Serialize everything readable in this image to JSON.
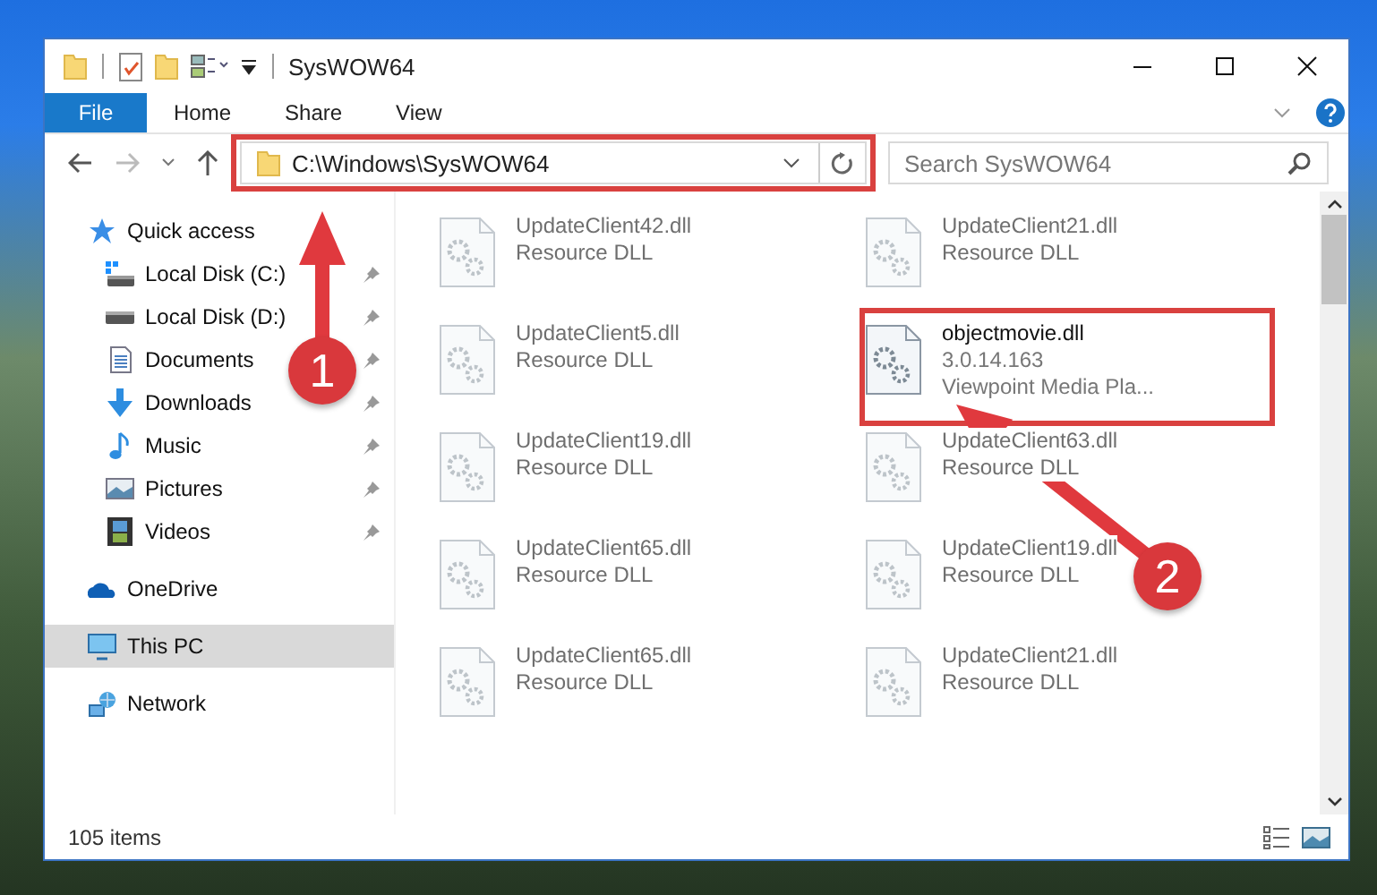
{
  "window": {
    "title": "SysWOW64"
  },
  "ribbon_tabs": [
    {
      "label": "File",
      "kind": "file_menu"
    },
    {
      "label": "Home",
      "kind": "tab"
    },
    {
      "label": "Share",
      "kind": "tab"
    },
    {
      "label": "View",
      "kind": "tab"
    }
  ],
  "address_bar": {
    "path": "C:\\Windows\\SysWOW64"
  },
  "search": {
    "placeholder": "Search SysWOW64"
  },
  "navigation": [
    {
      "label": "Quick access",
      "kind": "star",
      "selected": false,
      "children": [
        {
          "label": "Local Disk (C:)",
          "kind": "system_drive",
          "pinned": true
        },
        {
          "label": "Local Disk (D:)",
          "kind": "drive",
          "pinned": true
        },
        {
          "label": "Documents",
          "kind": "documents",
          "pinned": true
        },
        {
          "label": "Downloads",
          "kind": "downloads",
          "pinned": true
        },
        {
          "label": "Music",
          "kind": "music",
          "pinned": true
        },
        {
          "label": "Pictures",
          "kind": "pictures",
          "pinned": true
        },
        {
          "label": "Videos",
          "kind": "videos",
          "pinned": true
        }
      ]
    },
    {
      "label": "OneDrive",
      "kind": "cloud",
      "selected": false
    },
    {
      "label": "This PC",
      "kind": "pc",
      "selected": true
    },
    {
      "label": "Network",
      "kind": "network",
      "selected": false
    }
  ],
  "files": [
    {
      "name": "UpdateClient42.dll",
      "details": [
        "Resource DLL"
      ],
      "blurred": true
    },
    {
      "name": "UpdateClient21.dll",
      "details": [
        "Resource DLL"
      ],
      "blurred": true
    },
    {
      "name": "UpdateClient5.dll",
      "details": [
        "Resource DLL"
      ],
      "blurred": true
    },
    {
      "name": "objectmovie.dll",
      "details": [
        "3.0.14.163",
        "Viewpoint Media Pla..."
      ],
      "blurred": false
    },
    {
      "name": "UpdateClient19.dll",
      "details": [
        "Resource DLL"
      ],
      "blurred": true
    },
    {
      "name": "UpdateClient63.dll",
      "details": [
        "Resource DLL"
      ],
      "blurred": true
    },
    {
      "name": "UpdateClient65.dll",
      "details": [
        "Resource DLL"
      ],
      "blurred": true
    },
    {
      "name": "UpdateClient19.dll",
      "details": [
        "Resource DLL"
      ],
      "blurred": true
    },
    {
      "name": "UpdateClient65.dll",
      "details": [
        "Resource DLL"
      ],
      "blurred": true
    },
    {
      "name": "UpdateClient21.dll",
      "details": [
        "Resource DLL"
      ],
      "blurred": true
    }
  ],
  "status_bar": {
    "item_count": "105 items"
  },
  "annotations": [
    {
      "number": "1"
    },
    {
      "number": "2"
    }
  ]
}
